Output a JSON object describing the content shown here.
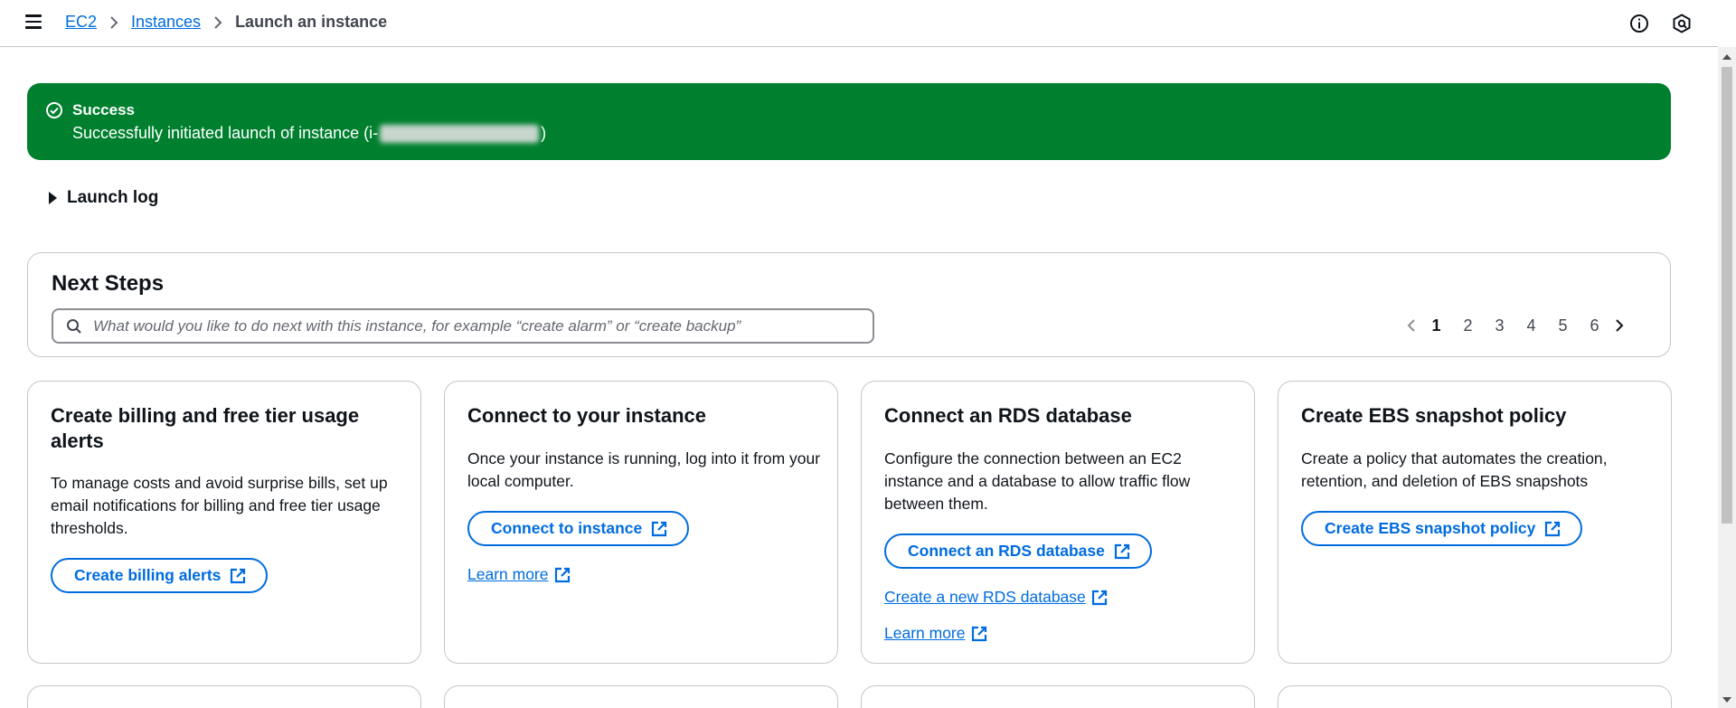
{
  "breadcrumb": {
    "items": [
      "EC2",
      "Instances"
    ],
    "current": "Launch an instance"
  },
  "flash": {
    "title": "Success",
    "message_prefix": "Successfully initiated launch of instance (i-",
    "message_suffix": ")"
  },
  "launch_log": {
    "label": "Launch log"
  },
  "next_steps": {
    "title": "Next Steps",
    "search_placeholder": "What would you like to do next with this instance, for example “create alarm” or “create backup”",
    "pages": [
      "1",
      "2",
      "3",
      "4",
      "5",
      "6"
    ],
    "current_page": "1"
  },
  "cards": [
    {
      "title": "Create billing and free tier usage alerts",
      "description": "To manage costs and avoid surprise bills, set up email notifications for billing and free tier usage thresholds.",
      "button": "Create billing alerts"
    },
    {
      "title": "Connect to your instance",
      "description": "Once your instance is running, log into it from your local computer.",
      "button": "Connect to instance",
      "links": [
        "Learn more"
      ]
    },
    {
      "title": "Connect an RDS database",
      "description": "Configure the connection between an EC2 instance and a database to allow traffic flow between them.",
      "button": "Connect an RDS database",
      "links": [
        "Create a new RDS database",
        "Learn more"
      ]
    },
    {
      "title": "Create EBS snapshot policy",
      "description": "Create a policy that automates the creation, retention, and deletion of EBS snapshots",
      "button": "Create EBS snapshot policy"
    }
  ],
  "colors": {
    "success": "#00802f",
    "link": "#006ce0",
    "border": "#c6c6cd",
    "text": "#0f141a"
  },
  "icons": {
    "menu": "hamburger-icon",
    "info": "info-icon",
    "notifications": "hexagon-icon",
    "success": "check-circle-icon",
    "search": "search-icon",
    "external": "external-link-icon"
  }
}
